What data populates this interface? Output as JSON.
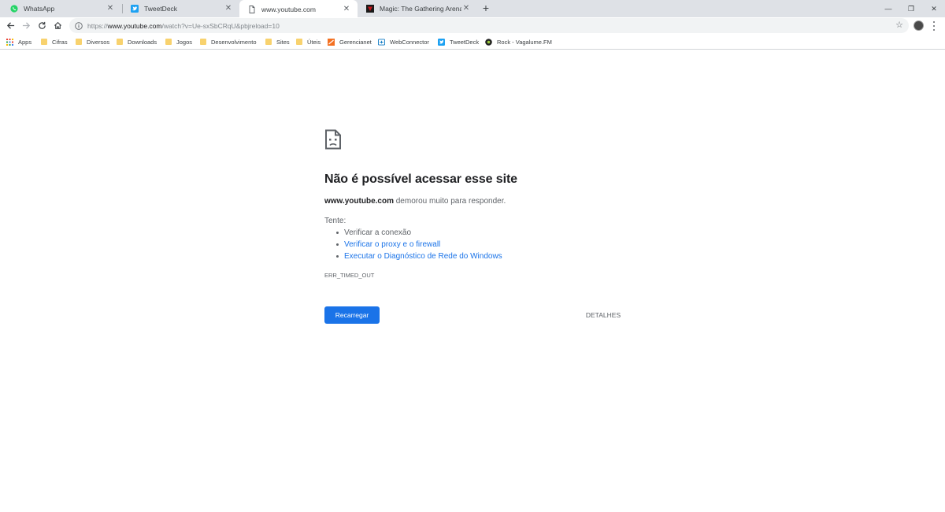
{
  "tabs": [
    {
      "title": "WhatsApp",
      "favicon": "whatsapp-icon",
      "color": "#25d366"
    },
    {
      "title": "TweetDeck",
      "favicon": "tweetdeck-icon",
      "color": "#1da1f2"
    },
    {
      "title": "www.youtube.com",
      "favicon": "page-icon",
      "color": "#5f6368",
      "active": true
    },
    {
      "title": "Magic: The Gathering Arena | MA",
      "favicon": "mtg-icon",
      "color": "#c4161c"
    }
  ],
  "window": {
    "minimize": "—",
    "restore": "❐",
    "close": "✕"
  },
  "toolbar": {
    "url_prefix": "https://",
    "url_host": "www.youtube.com",
    "url_path": "/watch?v=Ue-sxSbCRqU&pbjreload=10"
  },
  "bookmarks": [
    {
      "label": "Apps",
      "icon": "apps-grid-icon"
    },
    {
      "label": "Cifras",
      "icon": "folder-icon"
    },
    {
      "label": "Diversos",
      "icon": "folder-icon"
    },
    {
      "label": "Downloads",
      "icon": "folder-icon"
    },
    {
      "label": "Jogos",
      "icon": "folder-icon"
    },
    {
      "label": "Desenvolvimento",
      "icon": "folder-icon"
    },
    {
      "label": "Sites",
      "icon": "folder-icon"
    },
    {
      "label": "Úteis",
      "icon": "folder-icon"
    },
    {
      "label": "Gerencianet",
      "icon": "gerencianet-icon"
    },
    {
      "label": "WebConnector",
      "icon": "webconnector-icon"
    },
    {
      "label": "TweetDeck",
      "icon": "tweetdeck-icon"
    },
    {
      "label": "Rock - Vagalume.FM",
      "icon": "vagalume-icon"
    }
  ],
  "error": {
    "title": "Não é possível acessar esse site",
    "host": "www.youtube.com",
    "desc_suffix": " demorou muito para responder.",
    "try_label": "Tente:",
    "suggestions": [
      "Verificar a conexão",
      "Verificar o proxy e o firewall",
      "Executar o Diagnóstico de Rede do Windows"
    ],
    "code": "ERR_TIMED_OUT",
    "reload_label": "Recarregar",
    "details_label": "DETALHES"
  },
  "colors": {
    "accent": "#1a73e8",
    "tabstrip": "#dee1e6",
    "omnibox": "#f1f3f4"
  }
}
